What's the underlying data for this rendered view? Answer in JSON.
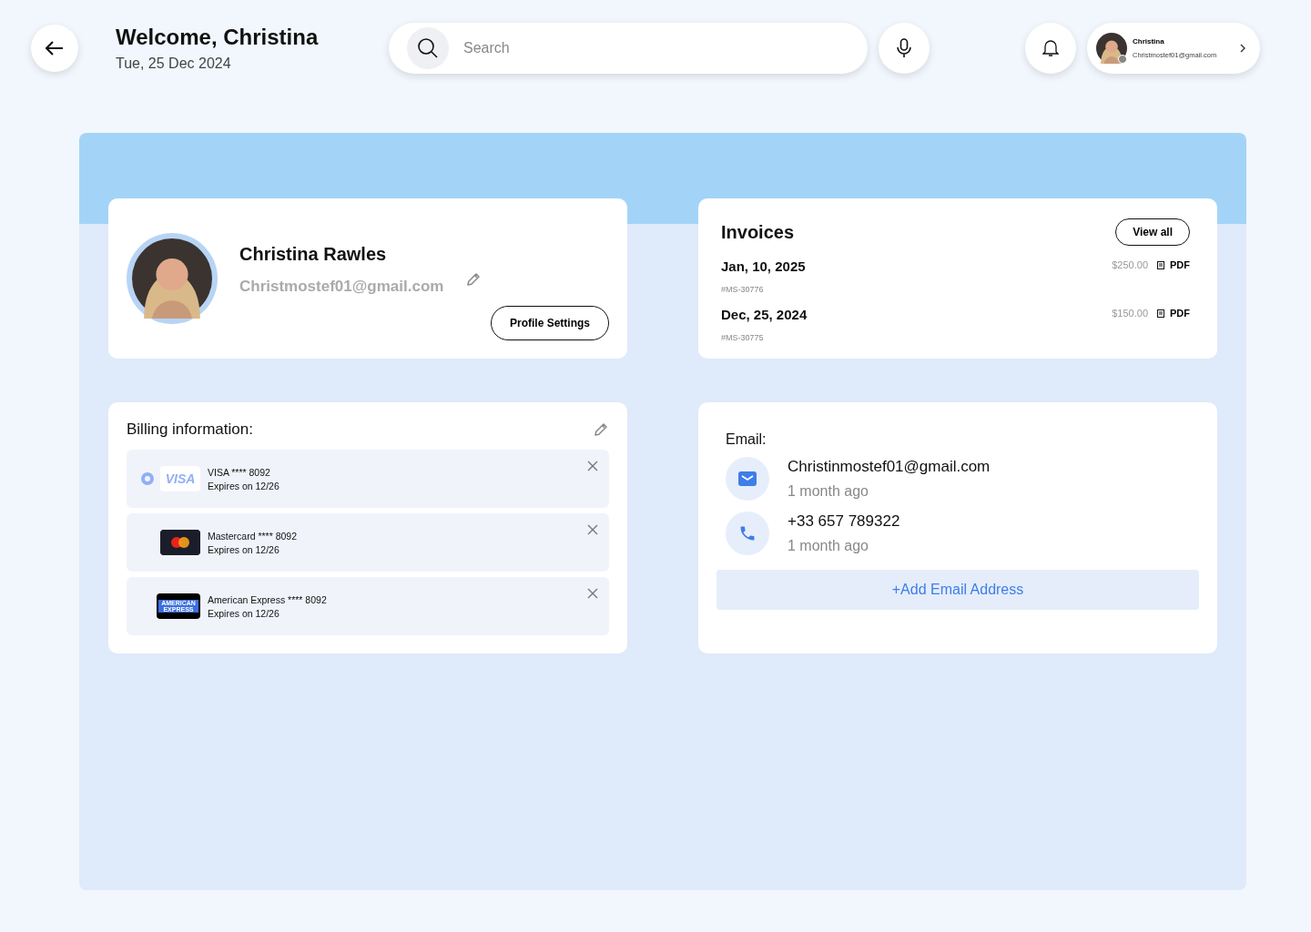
{
  "header": {
    "title": "Welcome, Christina",
    "date": "Tue, 25 Dec 2024"
  },
  "search": {
    "placeholder": "Search"
  },
  "account": {
    "name": "Christina",
    "email": "Christmostef01@gmail.com"
  },
  "profile": {
    "name": "Christina Rawles",
    "email": "Christmostef01@gmail.com",
    "button": "Profile Settings"
  },
  "invoices": {
    "title": "Invoices",
    "button": "View all",
    "items": [
      {
        "date": "Jan, 10, 2025",
        "number": "#MS-30776",
        "amount": "$250.00",
        "file": "PDF"
      },
      {
        "date": "Dec, 25, 2024",
        "number": "#MS-30775",
        "amount": "$150.00",
        "file": "PDF"
      }
    ]
  },
  "billing": {
    "title": "Billing information:",
    "cards": [
      {
        "kind": "visa",
        "logo_text": "VISA",
        "label": "VISA **** 8092",
        "expiry": "Expires on 12/26",
        "selected": true
      },
      {
        "kind": "mastercard",
        "label": "Mastercard **** 8092",
        "expiry": "Expires on 12/26",
        "selected": false
      },
      {
        "kind": "amex",
        "logo_text": "AMERICAN EXPRESS",
        "label": "American Express **** 8092",
        "expiry": "Expires on 12/26",
        "selected": false
      }
    ]
  },
  "contact": {
    "title": "Email:",
    "items": [
      {
        "kind": "email",
        "value": "Christinmostef01@gmail.com",
        "time": "1 month ago"
      },
      {
        "kind": "phone",
        "value": "+33 657 789322",
        "time": "1 month ago"
      }
    ],
    "add_button": "+Add Email Address"
  }
}
